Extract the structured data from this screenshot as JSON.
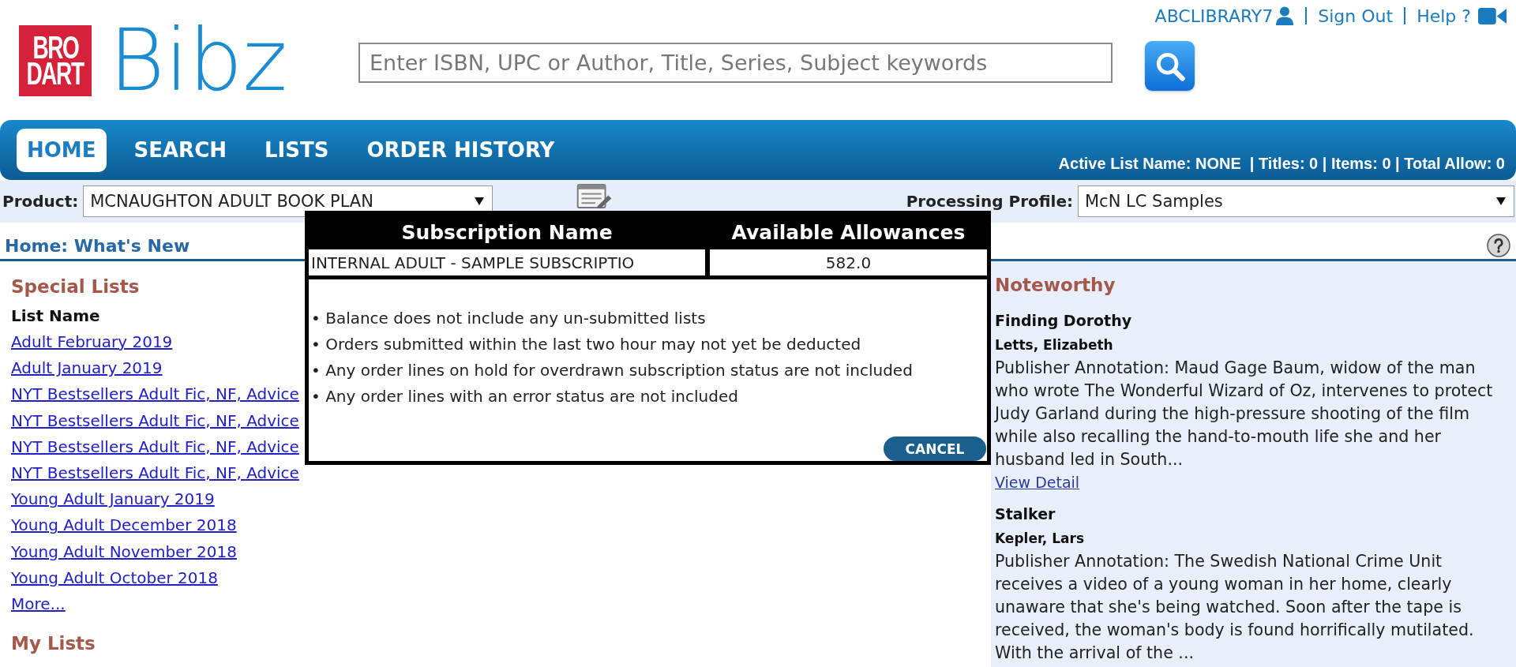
{
  "header": {
    "user_links": [
      {
        "kind": "user",
        "label": "ABCLIBRARY7"
      },
      {
        "kind": "link",
        "label": "Sign Out"
      },
      {
        "kind": "help",
        "label": "Help ?"
      }
    ],
    "logo": {
      "mark_lines": [
        "BRO",
        "DART"
      ],
      "wordmark": "Bibz"
    },
    "search": {
      "placeholder": "Enter ISBN, UPC or Author, Title, Series, Subject keywords"
    }
  },
  "nav": {
    "tabs": [
      {
        "label": "HOME",
        "selected": true
      },
      {
        "label": "SEARCH",
        "selected": false
      },
      {
        "label": "LISTS",
        "selected": false
      },
      {
        "label": "ORDER HISTORY",
        "selected": false
      }
    ],
    "active_list_summary": "Active List Name: NONE  | Titles: 0 | Items: 0 | Total Allow: 0"
  },
  "product_bar": {
    "product": {
      "label": "Product:",
      "value": "MCNAUGHTON ADULT BOOK PLAN"
    },
    "processing_profile": {
      "label": "Processing Profile:",
      "value": "McN LC Samples"
    }
  },
  "page": {
    "title": "Home: What's New"
  },
  "special_lists": {
    "title": "Special Lists",
    "column_header": "List Name",
    "items": [
      "Adult February 2019",
      "Adult January 2019",
      "NYT Bestsellers Adult Fic, NF, Advice",
      "NYT Bestsellers Adult Fic, NF, Advice",
      "NYT Bestsellers Adult Fic, NF, Advice",
      "NYT Bestsellers Adult Fic, NF, Advice",
      "Young Adult January 2019",
      "Young Adult December 2018",
      "Young Adult November 2018",
      "Young Adult October 2018"
    ],
    "more_link": "More..."
  },
  "my_lists": {
    "title": "My Lists"
  },
  "noteworthy": {
    "title": "Noteworthy",
    "items": [
      {
        "title": "Finding Dorothy",
        "author": "Letts, Elizabeth",
        "annotation": "Publisher Annotation: Maud Gage Baum, widow of the man who wrote The Wonderful Wizard of Oz, intervenes to protect Judy Garland during the high-pressure shooting of the film while also recalling the hand-to-mouth life she and her husband led in South...",
        "detail_link": "View Detail"
      },
      {
        "title": "Stalker",
        "author": "Kepler, Lars",
        "annotation": "Publisher Annotation: The Swedish National Crime Unit receives a video of a young woman in her home, clearly unaware that she's being watched. Soon after the tape is received, the woman's body is found horrifically mutilated. With the arrival of the ..."
      }
    ]
  },
  "allowance_dialog": {
    "columns": [
      "Subscription Name",
      "Available Allowances"
    ],
    "rows": [
      [
        "INTERNAL ADULT - SAMPLE SUBSCRIPTIO",
        "582.0"
      ]
    ],
    "notes": [
      "• Balance does not include any un-submitted lists",
      "• Orders submitted within the last two hour may not yet be deducted",
      "• Any order lines on hold for overdrawn subscription status are not included",
      "• Any order lines with an error status are not included"
    ],
    "buttons": [
      "CANCEL"
    ]
  }
}
